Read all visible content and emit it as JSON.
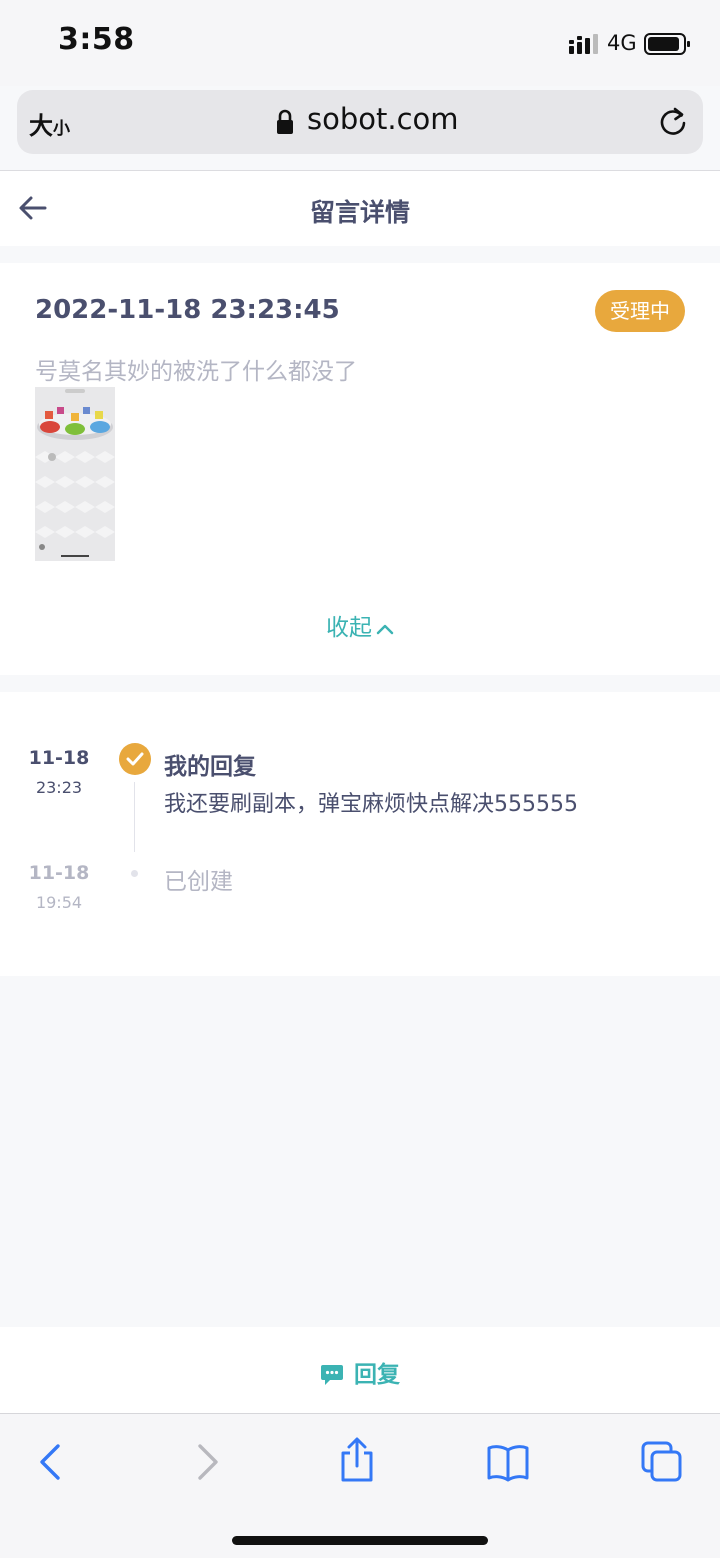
{
  "status_bar": {
    "time": "3:58",
    "network": "4G"
  },
  "browser": {
    "text_size_big": "大",
    "text_size_small": "小",
    "url": "sobot.com"
  },
  "nav": {
    "title": "留言详情"
  },
  "detail": {
    "time": "2022-11-18 23:23:45",
    "status": "受理中",
    "text": "号莫名其妙的被洗了什么都没了",
    "collapse_label": "收起"
  },
  "timeline": [
    {
      "date": "11-18",
      "time": "23:23",
      "title": "我的回复",
      "content": "我还要刷副本，弹宝麻烦快点解决555555"
    },
    {
      "date": "11-18",
      "time": "19:54",
      "title": "已创建"
    }
  ],
  "reply": {
    "label": "回复"
  },
  "colors": {
    "accent": "#3bb3b3",
    "badge": "#e8a83d",
    "title": "#4a4f6e",
    "muted": "#b4b6c4"
  }
}
